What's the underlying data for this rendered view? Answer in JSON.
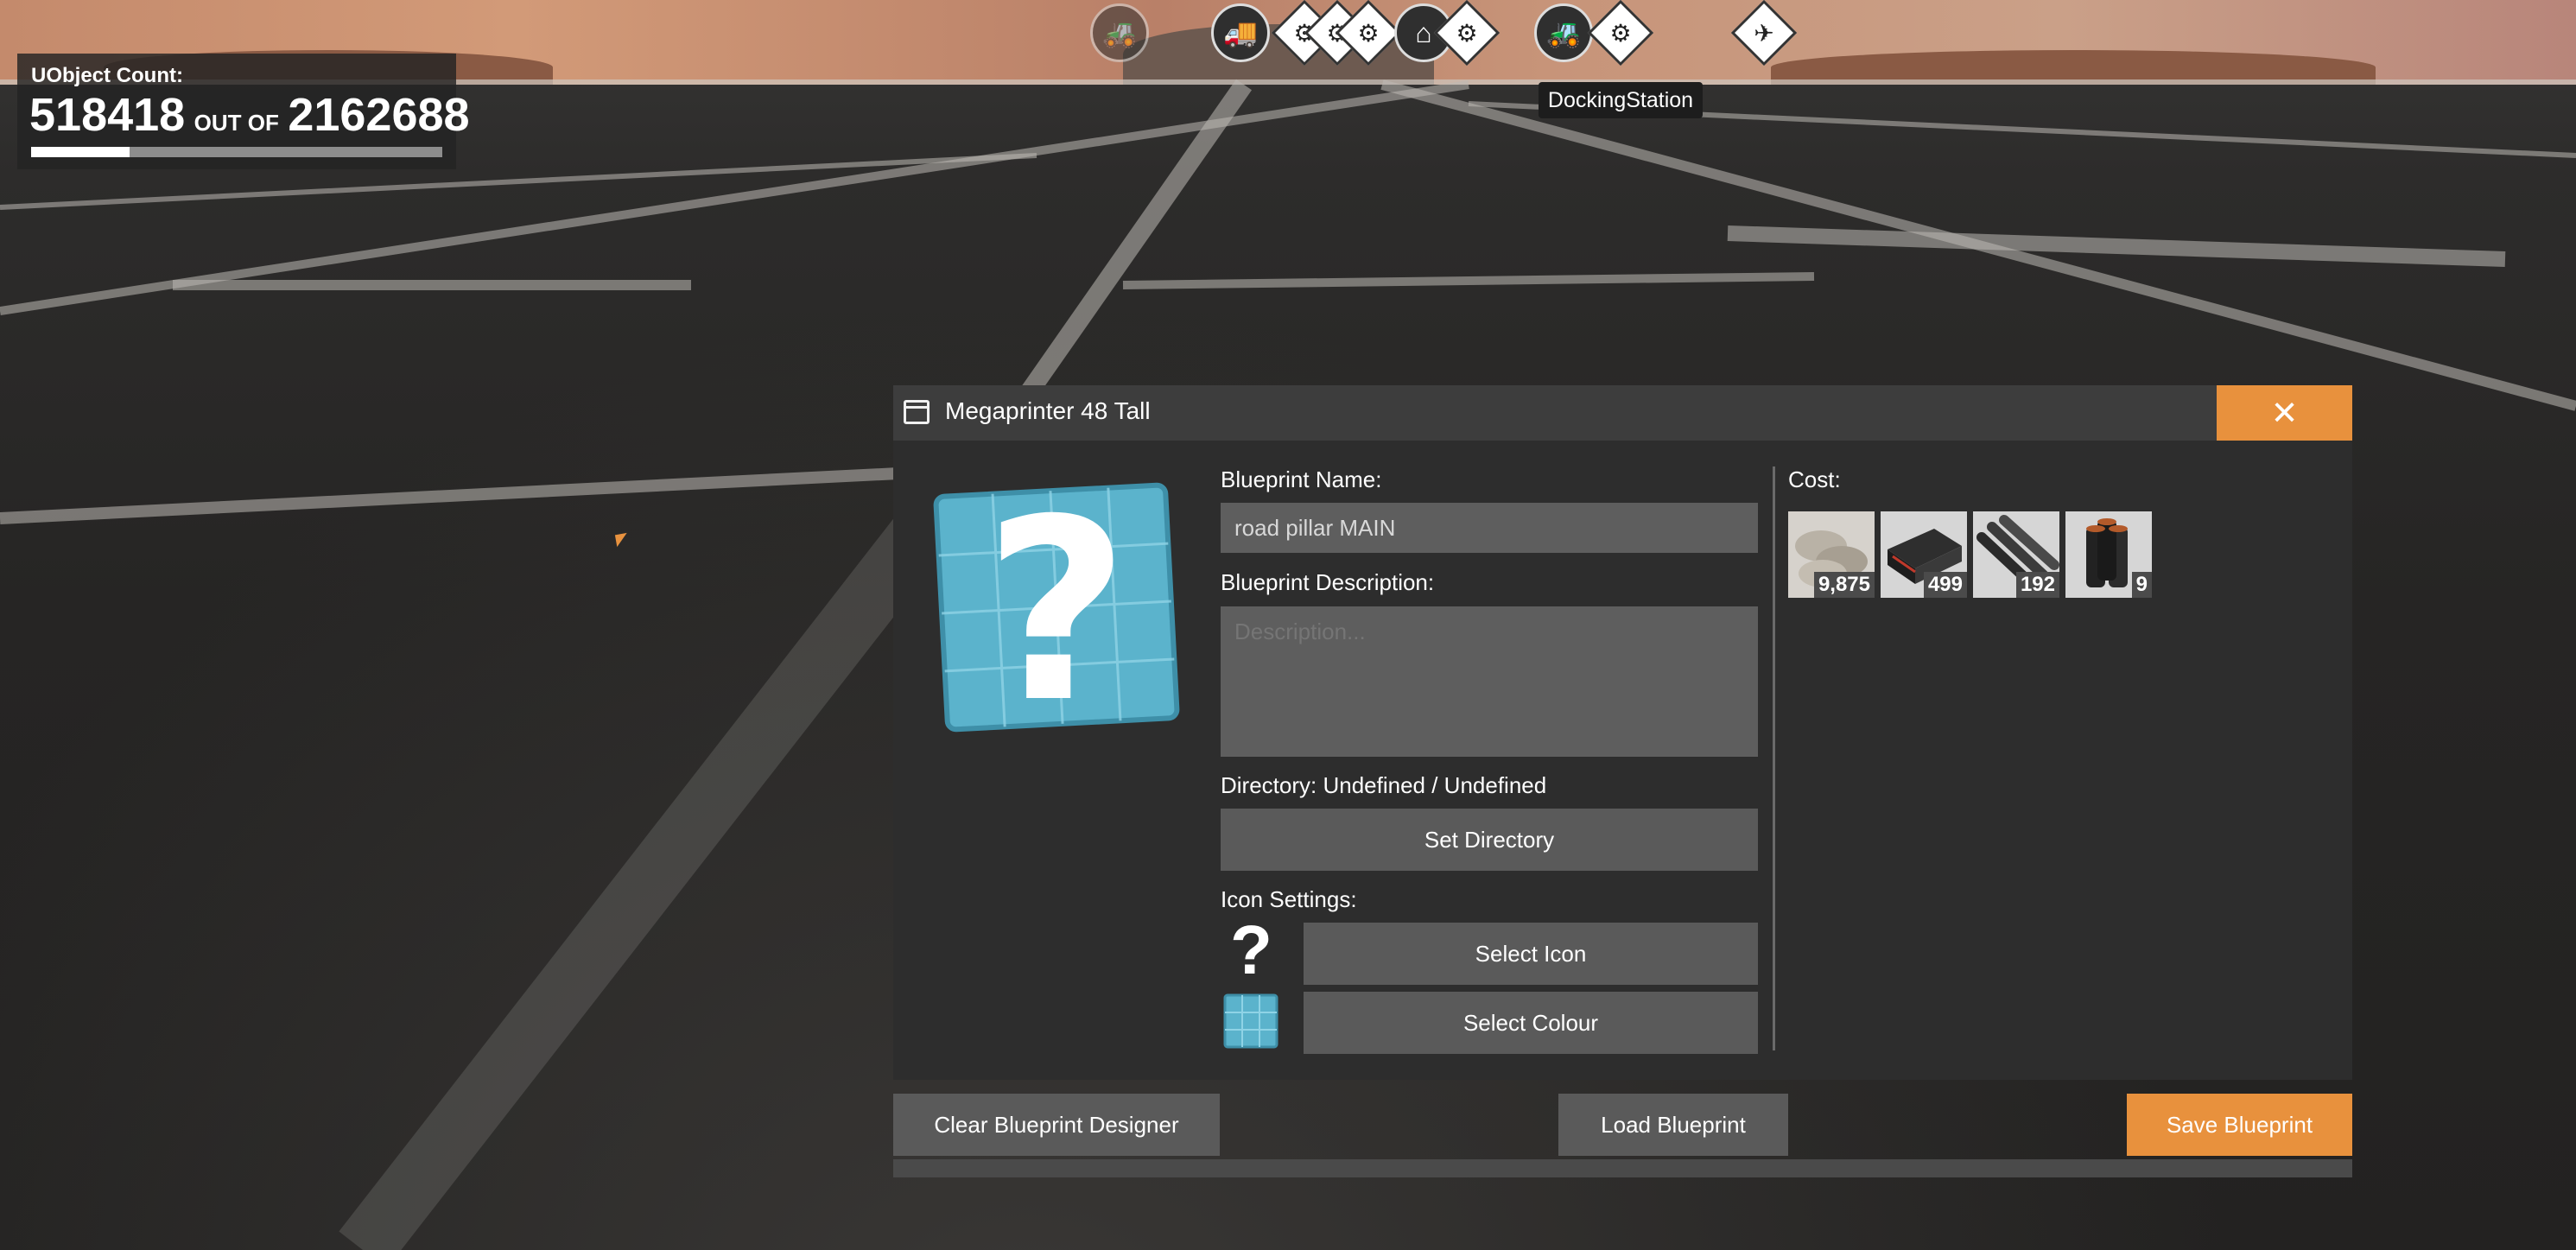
{
  "hud": {
    "uobject_label": "UObject Count:",
    "current": "518418",
    "out_of_label": "OUT OF",
    "total": "2162688",
    "progress_fraction": 0.24
  },
  "top_bar": {
    "tooltip": "DockingStation",
    "icons": [
      "tractor-icon",
      "truck-icon",
      "factory-icon",
      "factory-icon",
      "factory-icon",
      "house-icon",
      "factory-icon",
      "tractor-icon",
      "factory-icon",
      "drone-icon"
    ]
  },
  "dialog": {
    "title": "Megaprinter 48 Tall",
    "close_symbol": "✕",
    "blueprint_name_label": "Blueprint Name:",
    "blueprint_name_value": "road pillar MAIN",
    "description_label": "Blueprint Description:",
    "description_placeholder": "Description...",
    "directory_text": "Directory: Undefined / Undefined",
    "set_directory_button": "Set Directory",
    "icon_settings_label": "Icon Settings:",
    "icon_preview_glyph": "?",
    "select_icon_button": "Select Icon",
    "select_colour_button": "Select Colour",
    "cost_label": "Cost:",
    "cost_items": [
      {
        "icon": "concrete-bags-icon",
        "quantity": "9,875"
      },
      {
        "icon": "steel-frame-icon",
        "quantity": "499"
      },
      {
        "icon": "steel-pipes-icon",
        "quantity": "192"
      },
      {
        "icon": "rubber-pipes-icon",
        "quantity": "9"
      }
    ],
    "footer": {
      "clear_button": "Clear Blueprint Designer",
      "load_button": "Load Blueprint",
      "save_button": "Save Blueprint"
    }
  },
  "colors": {
    "accent": "#e8913d",
    "panel": "#2d2d2d",
    "button": "#5a5a5a",
    "blueprint_icon": "#5bb3cc"
  }
}
